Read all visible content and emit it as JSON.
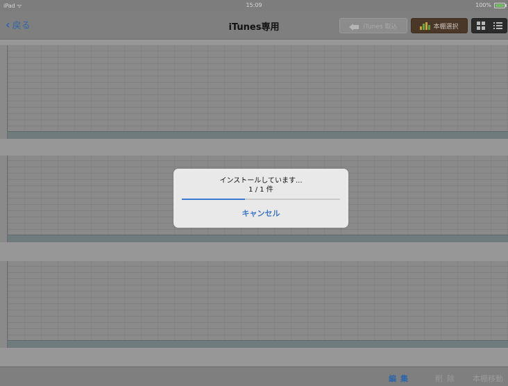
{
  "status_bar": {
    "device": "iPad ᯤ",
    "time": "15:09",
    "battery": "100%"
  },
  "nav": {
    "back_label": "戻る",
    "title": "iTunes専用",
    "itunes_button": "iTunes 取込",
    "shelf_button": "本棚選択"
  },
  "toolbar": {
    "edit": "編集",
    "delete": "削除",
    "move": "本棚移動"
  },
  "dialog": {
    "message": "インストールしています...",
    "count": "1 / 1 件",
    "cancel": "キャンセル",
    "progress": 0.4
  },
  "colors": {
    "accent": "#2f66a8",
    "progress": "#3b78d1",
    "battery": "#6fbf5f"
  },
  "icons": [
    "chevron-left-icon",
    "import-arrow-icon",
    "bar-chart-icon",
    "grid-view-icon",
    "list-view-icon",
    "wifi-icon",
    "battery-icon"
  ]
}
